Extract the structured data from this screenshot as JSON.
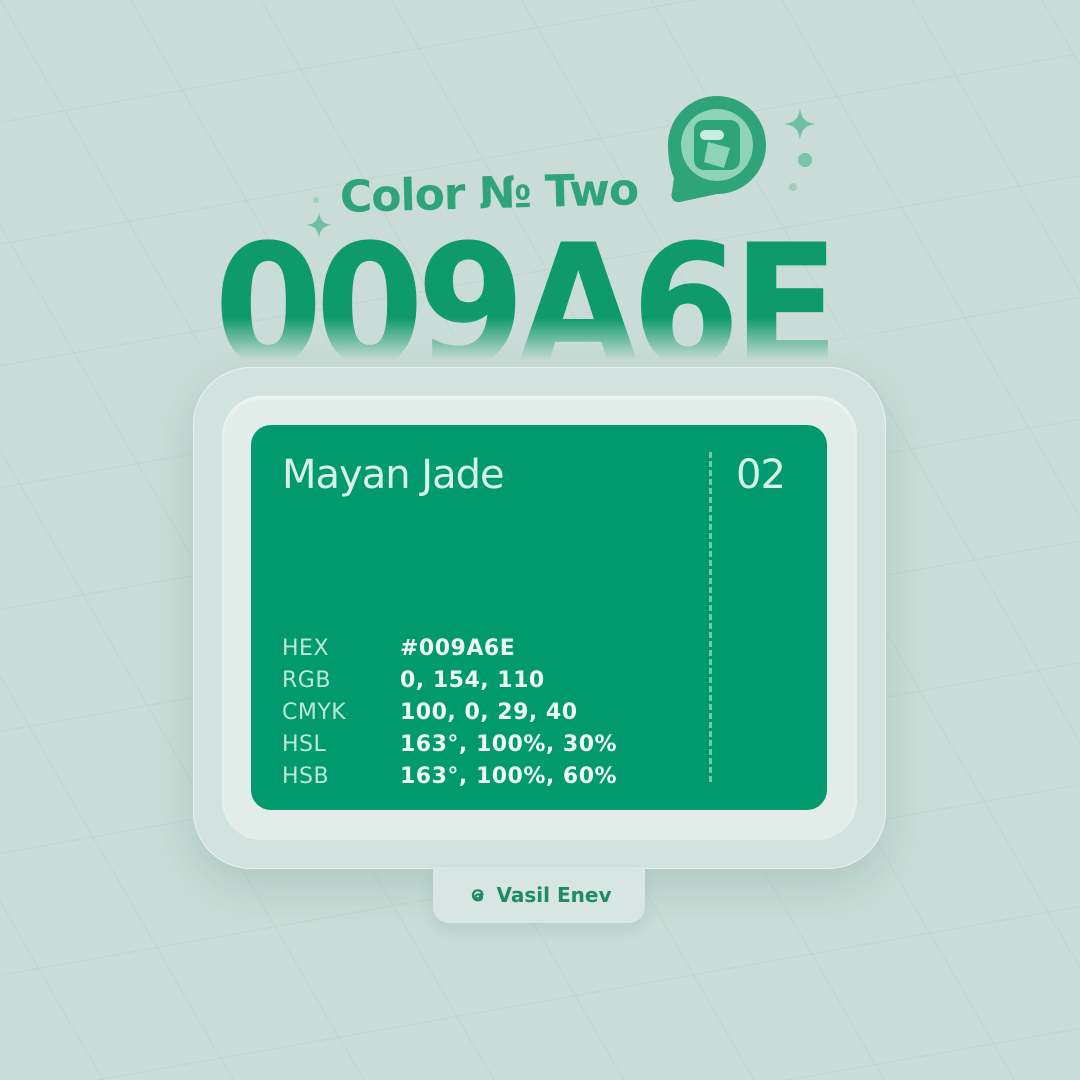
{
  "header": {
    "subtitle": "Color № Two",
    "hex_title": "009A6E"
  },
  "card": {
    "name": "Mayan Jade",
    "index": "02",
    "swatch_color": "#009A6E",
    "specs": [
      {
        "label": "HEX",
        "value": "#009A6E"
      },
      {
        "label": "RGB",
        "value": "0, 154, 110"
      },
      {
        "label": "CMYK",
        "value": "100, 0, 29, 40"
      },
      {
        "label": "HSL",
        "value": "163°, 100%, 30%"
      },
      {
        "label": "HSB",
        "value": "163°, 100%, 60%"
      }
    ]
  },
  "author": {
    "name": "Vasil Enev",
    "icon": "threads-icon"
  },
  "decor": {
    "badge_icon": "swatch-badge-icon",
    "sparkle_icon": "sparkle-icon",
    "accent_color": "#0F9A6C",
    "background_color": "#C9DCD7"
  }
}
